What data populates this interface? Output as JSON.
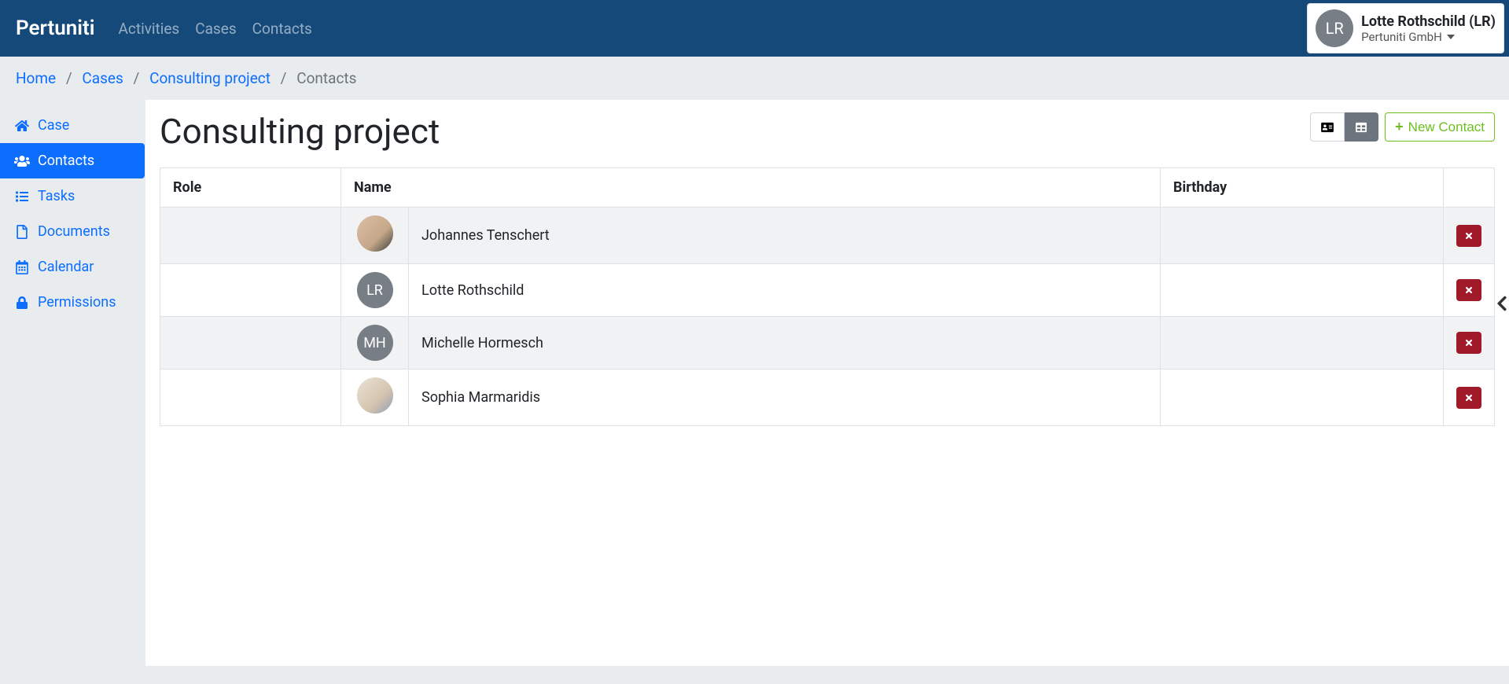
{
  "brand": "Pertuniti",
  "nav": {
    "items": [
      {
        "label": "Activities"
      },
      {
        "label": "Cases"
      },
      {
        "label": "Contacts"
      }
    ]
  },
  "user": {
    "initials": "LR",
    "name": "Lotte Rothschild (LR)",
    "org": "Pertuniti GmbH"
  },
  "breadcrumb": {
    "items": [
      {
        "label": "Home"
      },
      {
        "label": "Cases"
      },
      {
        "label": "Consulting project"
      }
    ],
    "current": "Contacts"
  },
  "sidebar": {
    "items": [
      {
        "label": "Case",
        "icon": "home"
      },
      {
        "label": "Contacts",
        "icon": "users",
        "active": true
      },
      {
        "label": "Tasks",
        "icon": "list"
      },
      {
        "label": "Documents",
        "icon": "file"
      },
      {
        "label": "Calendar",
        "icon": "calendar"
      },
      {
        "label": "Permissions",
        "icon": "lock"
      }
    ]
  },
  "page": {
    "title": "Consulting project",
    "new_contact_label": "New Contact"
  },
  "table": {
    "headers": {
      "role": "Role",
      "name": "Name",
      "birthday": "Birthday"
    },
    "rows": [
      {
        "role": "",
        "avatar_type": "photo",
        "initials": "",
        "name": "Johannes Tenschert",
        "birthday": ""
      },
      {
        "role": "",
        "avatar_type": "initials",
        "initials": "LR",
        "name": "Lotte Rothschild",
        "birthday": ""
      },
      {
        "role": "",
        "avatar_type": "initials",
        "initials": "MH",
        "name": "Michelle Hormesch",
        "birthday": ""
      },
      {
        "role": "",
        "avatar_type": "photo",
        "initials": "",
        "name": "Sophia Marmaridis",
        "birthday": ""
      }
    ]
  }
}
